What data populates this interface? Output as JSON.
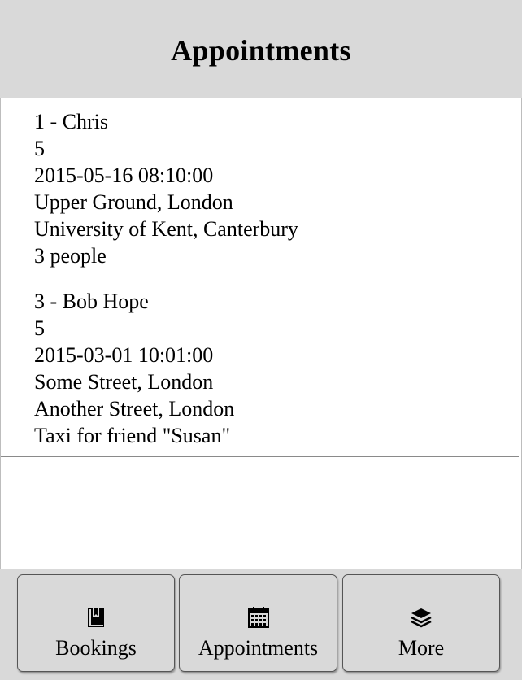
{
  "header": {
    "title": "Appointments"
  },
  "appointments": [
    {
      "title": "1 - Chris",
      "count": "5",
      "datetime": "2015-05-16 08:10:00",
      "from": "Upper Ground, London",
      "to": "University of Kent, Canterbury",
      "note": "3 people"
    },
    {
      "title": "3 - Bob Hope",
      "count": "5",
      "datetime": "2015-03-01 10:01:00",
      "from": "Some Street, London",
      "to": "Another Street, London",
      "note": "Taxi for friend \"Susan\""
    }
  ],
  "nav": {
    "items": [
      {
        "label": "Bookings",
        "icon": "book-icon"
      },
      {
        "label": "Appointments",
        "icon": "calendar-icon"
      },
      {
        "label": "More",
        "icon": "layers-icon"
      }
    ]
  },
  "colors": {
    "header_bg": "#d9d9d9",
    "navbar_bg": "#d9d9d9",
    "divider": "#8a8a8a"
  }
}
